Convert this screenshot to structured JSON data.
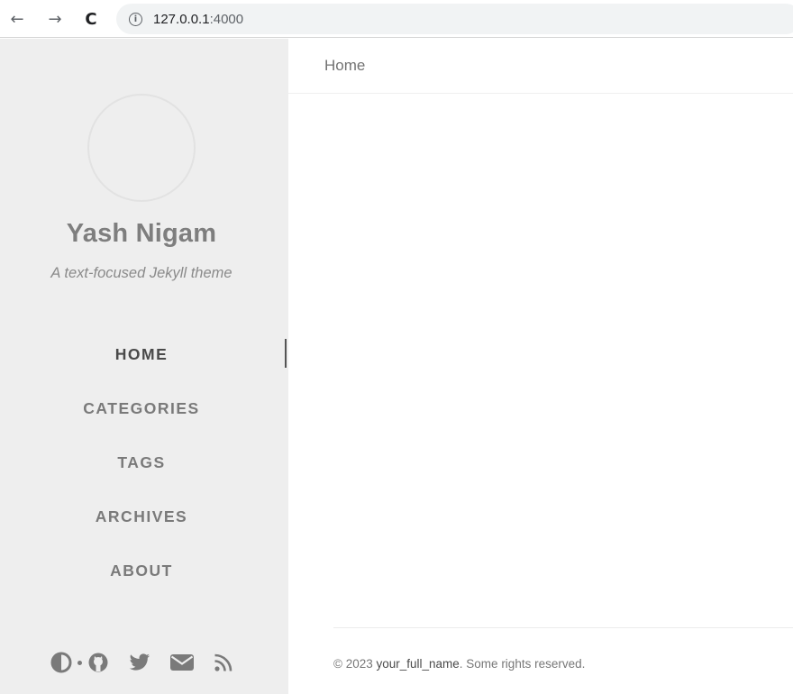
{
  "browser": {
    "back_label": "←",
    "forward_label": "→",
    "reload_label": "C",
    "info_icon_glyph": "i",
    "url_host": "127.0.0.1",
    "url_port": ":4000"
  },
  "sidebar": {
    "title": "Yash Nigam",
    "subtitle": "A text-focused Jekyll theme",
    "nav": [
      {
        "label": "HOME",
        "active": true
      },
      {
        "label": "CATEGORIES",
        "active": false
      },
      {
        "label": "TAGS",
        "active": false
      },
      {
        "label": "ARCHIVES",
        "active": false
      },
      {
        "label": "ABOUT",
        "active": false
      }
    ],
    "footer_icons": [
      "theme-toggle-icon",
      "github-icon",
      "twitter-icon",
      "email-icon",
      "rss-icon"
    ]
  },
  "topbar": {
    "breadcrumb": "Home"
  },
  "footer": {
    "prefix": "© 2023 ",
    "name": "your_full_name",
    "suffix": ". Some rights reserved."
  },
  "colors": {
    "sidebar_bg": "#eeeeee",
    "icon_color": "#7a7a7a",
    "active_text": "#4a4a4a"
  }
}
